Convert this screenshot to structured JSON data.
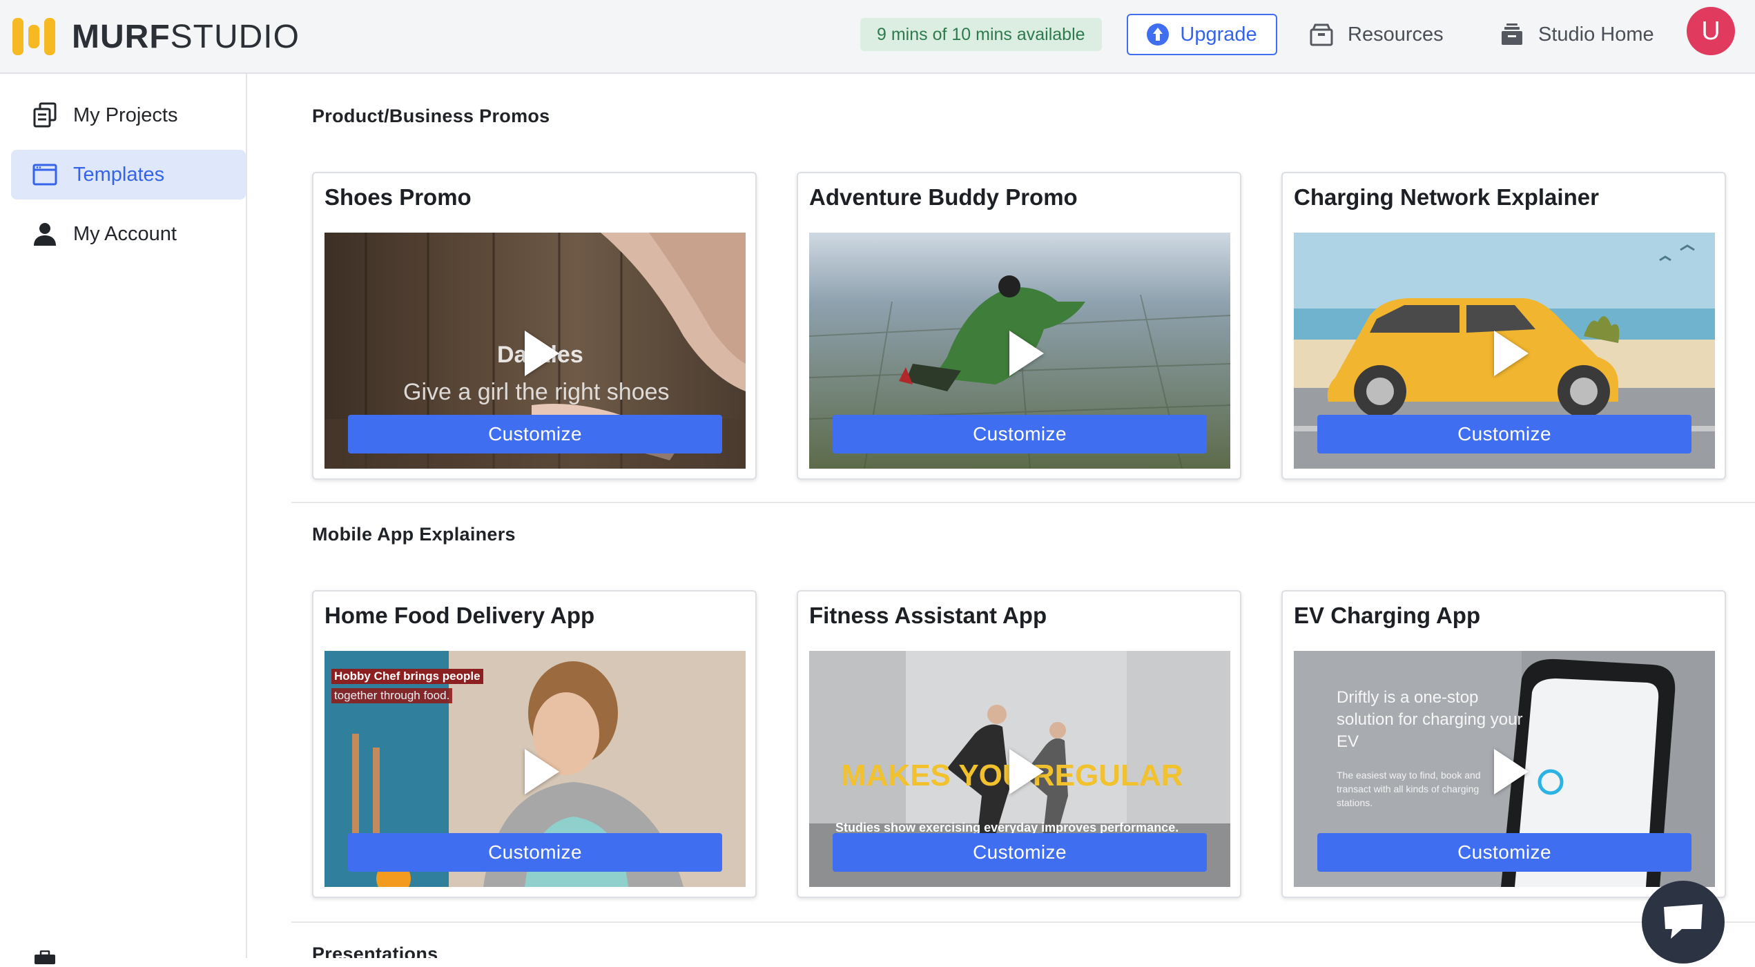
{
  "header": {
    "logo_bold": "MURF",
    "logo_light": "STUDIO",
    "minutes_status": "9 mins of 10 mins available",
    "upgrade_label": "Upgrade",
    "resources_label": "Resources",
    "studio_home_label": "Studio Home",
    "avatar_initial": "U"
  },
  "sidebar": {
    "items": [
      {
        "label": "My Projects",
        "icon": "projects-icon"
      },
      {
        "label": "Templates",
        "icon": "templates-icon",
        "active": true
      },
      {
        "label": "My Account",
        "icon": "person-icon"
      }
    ]
  },
  "sections": [
    {
      "title": "Product/Business Promos",
      "cards": [
        {
          "title": "Shoes Promo",
          "customize_label": "Customize",
          "thumb_text_1": "Dazzles",
          "thumb_text_2": "Give a girl the right shoes"
        },
        {
          "title": "Adventure Buddy Promo",
          "customize_label": "Customize"
        },
        {
          "title": "Charging Network Explainer",
          "customize_label": "Customize"
        }
      ]
    },
    {
      "title": "Mobile App Explainers",
      "cards": [
        {
          "title": "Home Food Delivery App",
          "customize_label": "Customize",
          "thumb_text_1": "Hobby Chef brings people",
          "thumb_text_2": "together through food."
        },
        {
          "title": "Fitness Assistant App",
          "customize_label": "Customize",
          "thumb_text_1": "MAKES YOU REGULAR",
          "thumb_text_2": "Studies show exercising everyday  improves performance."
        },
        {
          "title": "EV Charging App",
          "customize_label": "Customize",
          "thumb_text_1": "Driftly is a one-stop solution for charging your EV",
          "thumb_text_2": "The easiest way to find, book and transact with all kinds of charging stations."
        }
      ]
    },
    {
      "title": "Presentations"
    }
  ],
  "colors": {
    "accent": "#3f6ef0",
    "logo": "#f6b921",
    "avatar": "#e13a5f",
    "minutes_pill_bg": "#dbeee1",
    "minutes_pill_text": "#2e7a4f"
  }
}
